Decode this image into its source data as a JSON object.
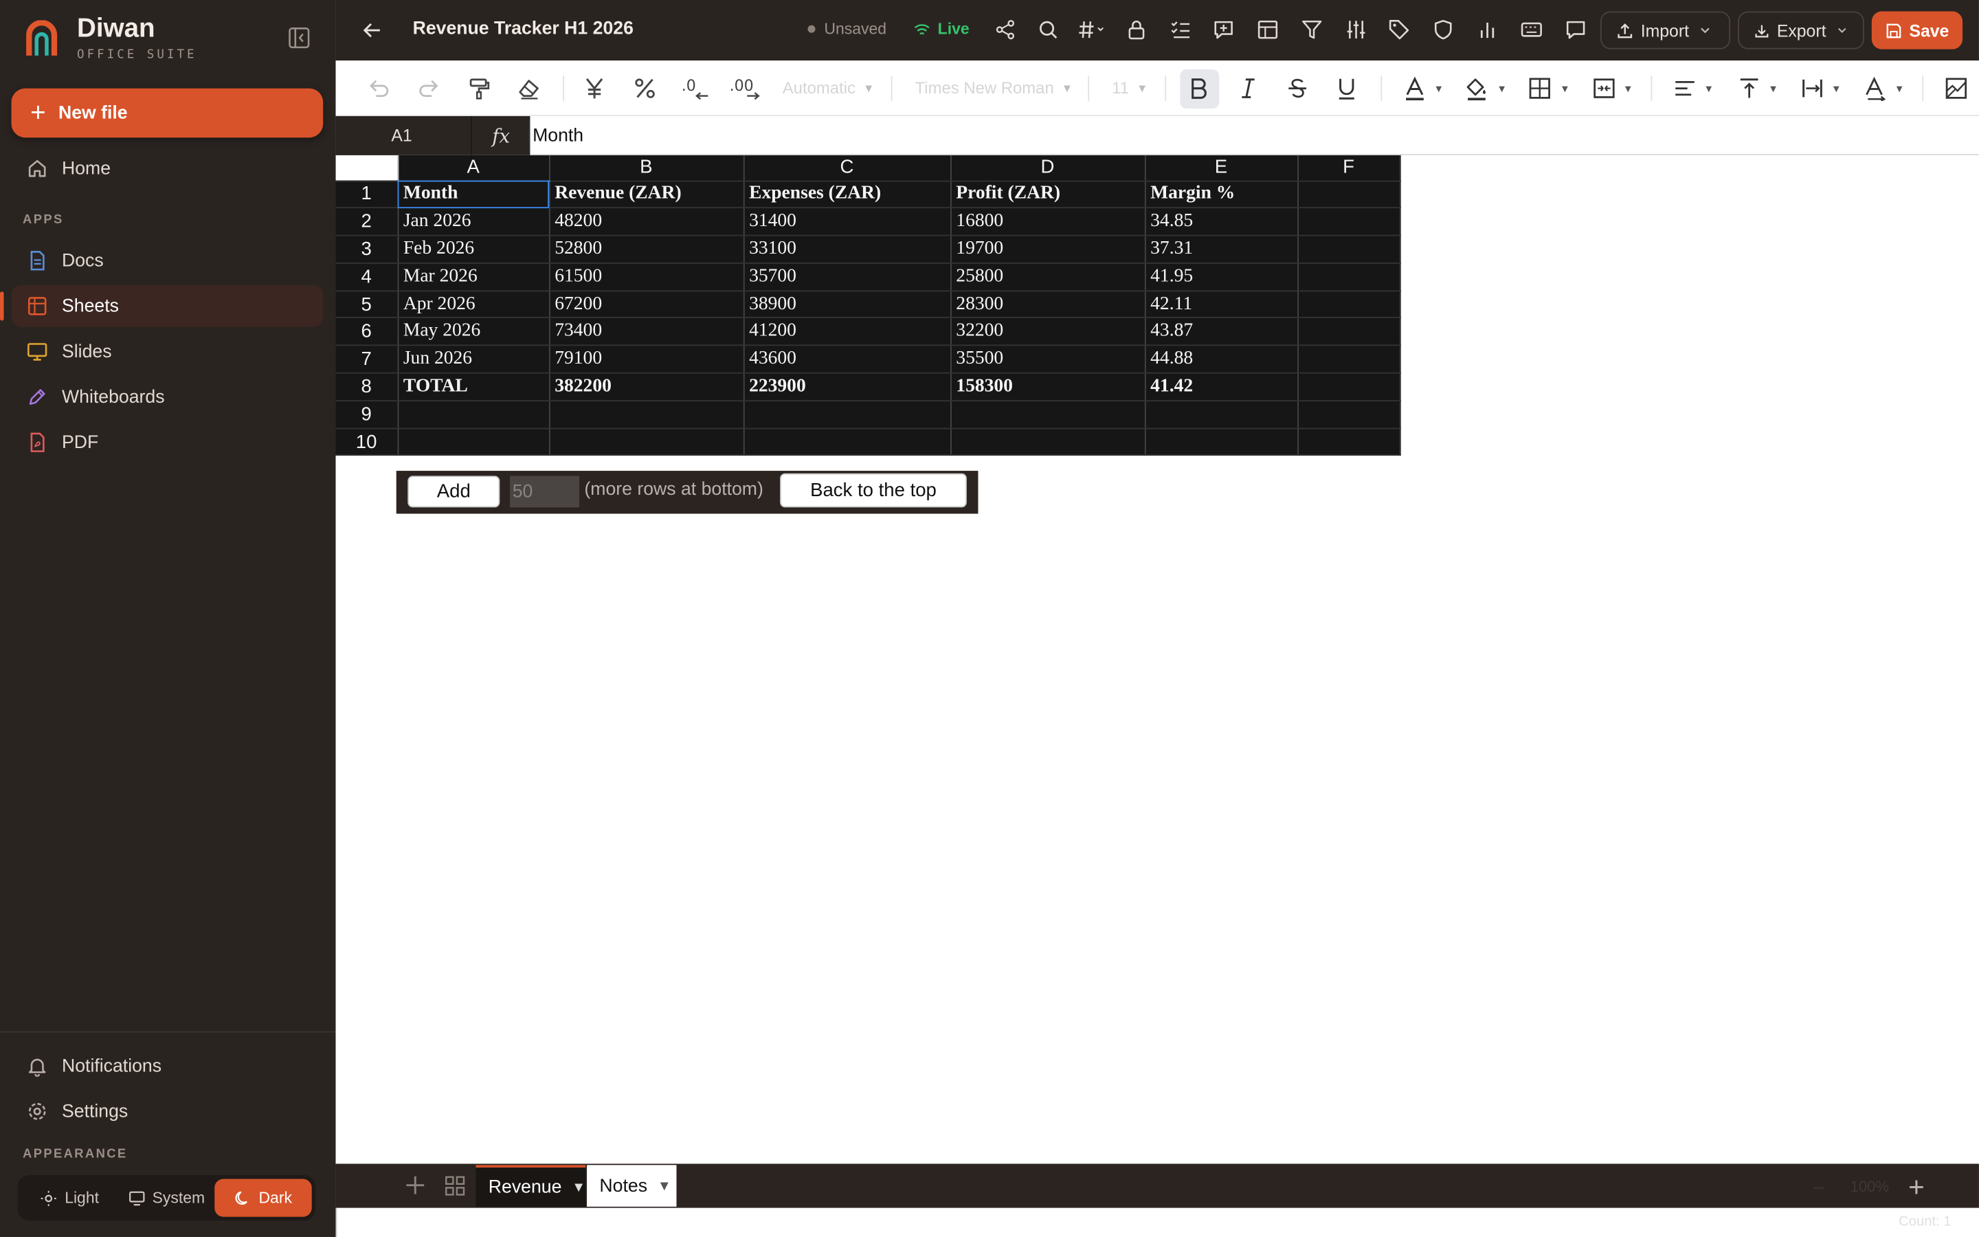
{
  "brand": {
    "name": "Diwan",
    "subtitle": "OFFICE SUITE"
  },
  "sidebar": {
    "new_file": "New file",
    "home": "Home",
    "apps_label": "APPS",
    "items": [
      {
        "label": "Docs",
        "icon": "doc-icon",
        "color": "#5b8fd9"
      },
      {
        "label": "Sheets",
        "icon": "sheet-icon",
        "color": "#e0572c"
      },
      {
        "label": "Slides",
        "icon": "slides-icon",
        "color": "#e0a52c"
      },
      {
        "label": "Whiteboards",
        "icon": "pen-icon",
        "color": "#a676e0"
      },
      {
        "label": "PDF",
        "icon": "pdf-icon",
        "color": "#e05a5a"
      }
    ],
    "notifications": "Notifications",
    "settings": "Settings",
    "appearance_label": "APPEARANCE",
    "appearance": {
      "light": "Light",
      "system": "System",
      "dark": "Dark"
    }
  },
  "topbar": {
    "title": "Revenue Tracker H1 2026",
    "status": "Unsaved",
    "live": "Live",
    "import": "Import",
    "export": "Export",
    "save": "Save"
  },
  "toolbar": {
    "number_format": "Automatic",
    "font": "Times New Roman",
    "font_size": "11"
  },
  "formula": {
    "cell": "A1",
    "fx": "fx",
    "value": "Month"
  },
  "grid": {
    "columns": [
      "A",
      "B",
      "C",
      "D",
      "E",
      "F"
    ],
    "rows": [
      [
        "Month",
        "Revenue (ZAR)",
        "Expenses (ZAR)",
        "Profit (ZAR)",
        "Margin %",
        ""
      ],
      [
        "Jan 2026",
        "48200",
        "31400",
        "16800",
        "34.85",
        ""
      ],
      [
        "Feb 2026",
        "52800",
        "33100",
        "19700",
        "37.31",
        ""
      ],
      [
        "Mar 2026",
        "61500",
        "35700",
        "25800",
        "41.95",
        ""
      ],
      [
        "Apr 2026",
        "67200",
        "38900",
        "28300",
        "42.11",
        ""
      ],
      [
        "May 2026",
        "73400",
        "41200",
        "32200",
        "43.87",
        ""
      ],
      [
        "Jun 2026",
        "79100",
        "43600",
        "35500",
        "44.88",
        ""
      ],
      [
        "TOTAL",
        "382200",
        "223900",
        "158300",
        "41.42",
        ""
      ],
      [
        "",
        "",
        "",
        "",
        "",
        ""
      ],
      [
        "",
        "",
        "",
        "",
        "",
        ""
      ]
    ]
  },
  "addrows": {
    "add": "Add",
    "count": "50",
    "hint": "(more rows at bottom)",
    "back_top": "Back to the top"
  },
  "tabs": [
    {
      "label": "Revenue"
    },
    {
      "label": "Notes"
    }
  ],
  "footer": {
    "zoom": "100%",
    "count": "Count: 1"
  },
  "colors": {
    "accent": "#d9532a",
    "sidebar_bg": "#2a2421",
    "live": "#34c46a"
  }
}
